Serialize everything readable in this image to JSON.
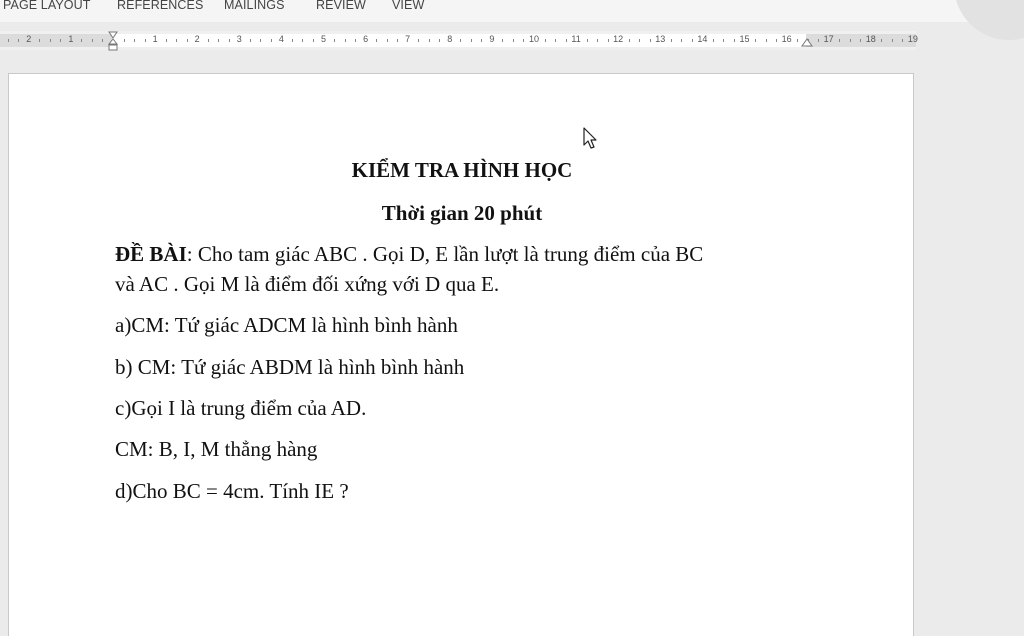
{
  "ribbon": {
    "tabs": [
      "PAGE LAYOUT",
      "REFERENCES",
      "MAILINGS",
      "REVIEW",
      "VIEW"
    ]
  },
  "ruler": {
    "left_numbers": [
      "2",
      "1"
    ],
    "right_numbers": [
      "1",
      "2",
      "3",
      "4",
      "5",
      "6",
      "7",
      "8",
      "9",
      "10",
      "11",
      "12",
      "13",
      "14",
      "15",
      "16",
      "17",
      "18",
      "19"
    ]
  },
  "document": {
    "title": "KIỂM TRA HÌNH HỌC",
    "subtitle": "Thời gian 20 phút",
    "problem_label": "ĐỀ BÀI",
    "problem_text_line1": ": Cho tam giác ABC . Gọi D, E lần lượt là trung điểm của BC",
    "problem_text_line2": "và AC . Gọi M là điểm đối xứng với D qua E.",
    "part_a": "a)CM: Tứ giác ADCM là hình bình hành",
    "part_b": "b) CM: Tứ giác ABDM là hình bình hành",
    "part_c": "c)Gọi I là trung điểm của AD.",
    "part_c2": "CM: B, I, M thẳng hàng",
    "part_d": "d)Cho BC = 4cm.   Tính IE ?"
  },
  "icons": {
    "cursor": "mouse-pointer-icon",
    "indent": "hanging-indent-icon"
  }
}
